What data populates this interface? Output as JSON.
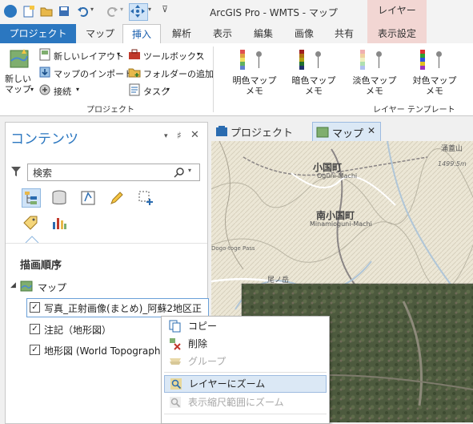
{
  "title_bar": {
    "title": "ArcGIS Pro - WMTS - マップ",
    "context_header": "レイヤー"
  },
  "ribbon_tabs": [
    "プロジェクト",
    "マップ",
    "挿入",
    "解析",
    "表示",
    "編集",
    "画像",
    "共有",
    "表示設定"
  ],
  "ribbon": {
    "new_map": "新しい\nマップ",
    "new_layout": "新しいレイアウト",
    "import_map": "マップのインポート",
    "connect": "接続",
    "toolbox": "ツールボックス",
    "add_folder": "フォルダーの追加",
    "task": "タスク",
    "group_project": "プロジェクト",
    "templates": [
      {
        "label": "明色マップ\nメモ",
        "colors": [
          "#e05050",
          "#e0a040",
          "#f0e060",
          "#60b060",
          "#6080d0"
        ]
      },
      {
        "label": "暗色マップ\nメモ",
        "colors": [
          "#a02020",
          "#b07010",
          "#b0a010",
          "#207030",
          "#203070"
        ]
      },
      {
        "label": "淡色マップ\nメモ",
        "colors": [
          "#f0b0b0",
          "#f0d0a0",
          "#f0f0c0",
          "#b0e0b0",
          "#b0c0f0"
        ]
      },
      {
        "label": "対色マップ\nメモ",
        "colors": [
          "#e03030",
          "#30a030",
          "#3050e0",
          "#e0c020",
          "#a030c0"
        ]
      }
    ],
    "group_layer_template": "レイヤー テンプレート"
  },
  "contents": {
    "title": "コンテンツ",
    "search_placeholder": "検索",
    "draw_order": "描画順序",
    "map_label": "マップ",
    "layers": [
      {
        "label": "写真_正射画像(まとめ)_阿蘇2地区正",
        "checked": true,
        "selected": true
      },
      {
        "label": "注記（地形図）",
        "checked": true,
        "selected": false
      },
      {
        "label": "地形図 (World Topographic",
        "checked": true,
        "selected": false
      }
    ]
  },
  "view_tabs": {
    "project": "プロジェクト",
    "map": "マップ"
  },
  "map_labels": {
    "oguni": "小国町",
    "oguni_en": "Oguni-Machi",
    "minamioguni": "南小国町",
    "minamioguni_en": "Minamioguni-Machi",
    "watanabe": "涌蓋山",
    "watanabe_elev": "1499.5m",
    "dogotoge": "Dogo-toge Pass",
    "onotake": "尾ノ岳"
  },
  "context_menu": [
    {
      "label": "コピー",
      "enabled": true,
      "icon": "copy-icon"
    },
    {
      "label": "削除",
      "enabled": true,
      "icon": "delete-icon"
    },
    {
      "label": "グループ",
      "enabled": false,
      "icon": "group-icon"
    },
    {
      "label": "レイヤーにズーム",
      "enabled": true,
      "highlight": true,
      "icon": "zoom-layer-icon"
    },
    {
      "label": "表示縮尺範囲にズーム",
      "enabled": false,
      "icon": "zoom-scale-icon"
    }
  ]
}
